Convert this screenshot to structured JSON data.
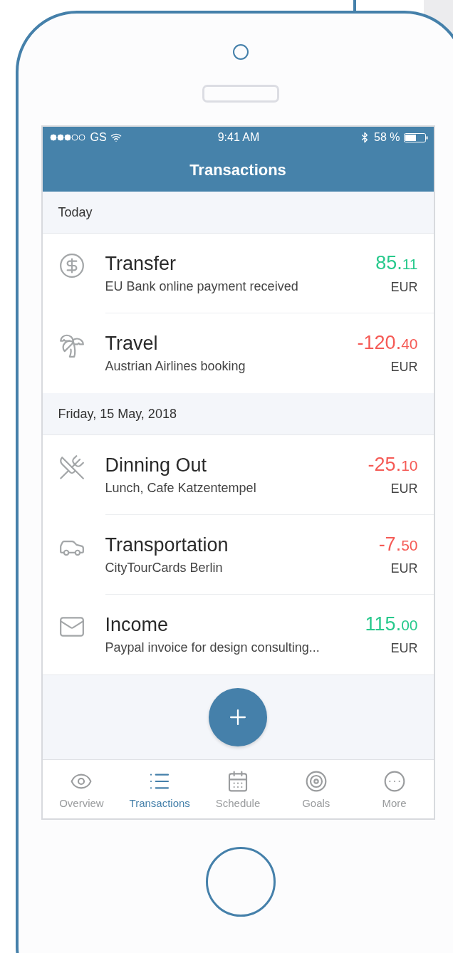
{
  "status_bar": {
    "carrier": "GS",
    "time": "9:41 AM",
    "battery": "58 %"
  },
  "nav": {
    "title": "Transactions"
  },
  "sections": [
    {
      "header": "Today",
      "rows": [
        {
          "title": "Transfer",
          "subtitle": "EU Bank online payment received",
          "whole": "85.",
          "cents": "11",
          "currency": "EUR",
          "kind": "income"
        },
        {
          "title": "Travel",
          "subtitle": "Austrian Airlines booking",
          "whole": "-120.",
          "cents": "40",
          "currency": "EUR",
          "kind": "expense"
        }
      ]
    },
    {
      "header": "Friday, 15 May, 2018",
      "rows": [
        {
          "title": "Dinning Out",
          "subtitle": "Lunch, Cafe Katzentempel",
          "whole": "-25.",
          "cents": "10",
          "currency": "EUR",
          "kind": "expense"
        },
        {
          "title": "Transportation",
          "subtitle": "CityTourCards Berlin",
          "whole": "-7.",
          "cents": "50",
          "currency": "EUR",
          "kind": "expense"
        },
        {
          "title": "Income",
          "subtitle": "Paypal invoice for design consulting...",
          "whole": "115.",
          "cents": "00",
          "currency": "EUR",
          "kind": "income"
        }
      ]
    }
  ],
  "tab_bar": [
    {
      "label": "Overview",
      "selected": false
    },
    {
      "label": "Transactions",
      "selected": true
    },
    {
      "label": "Schedule",
      "selected": false
    },
    {
      "label": "Goals",
      "selected": false
    },
    {
      "label": "More",
      "selected": false
    }
  ]
}
